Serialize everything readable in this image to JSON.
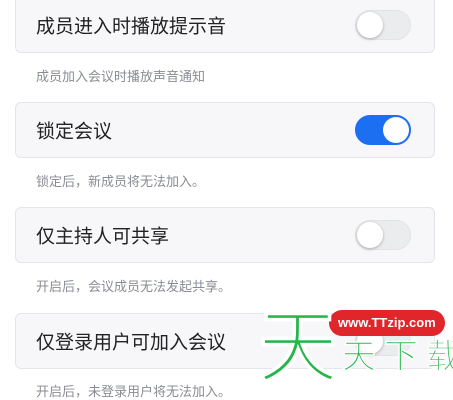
{
  "settings": [
    {
      "label": "成员进入时播放提示音",
      "enabled": false,
      "hint": "成员加入会议时播放声音通知"
    },
    {
      "label": "锁定会议",
      "enabled": true,
      "hint": "锁定后，新成员将无法加入。"
    },
    {
      "label": "仅主持人可共享",
      "enabled": false,
      "hint": "开启后，会议成员无法发起共享。"
    },
    {
      "label": "仅登录用户可加入会议",
      "enabled": false,
      "hint": "开启后，未登录用户将无法加入。"
    }
  ],
  "watermark": {
    "url": "www.TTzip.com",
    "big_char": "天",
    "small_chars": "天下载"
  },
  "colors": {
    "toggle_on": "#1d6ff2",
    "toggle_off": "#ebecee",
    "watermark_green": "#27b54a",
    "watermark_red": "#e0262a"
  }
}
